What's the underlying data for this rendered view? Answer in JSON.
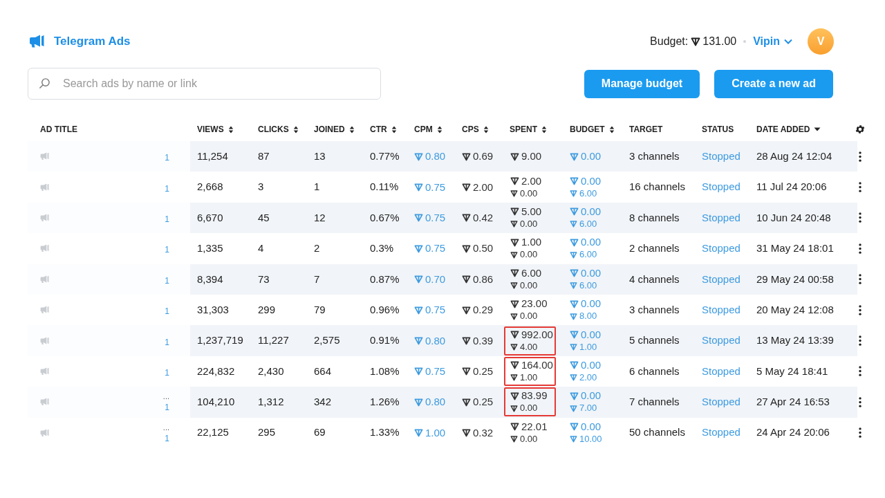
{
  "header": {
    "brand": "Telegram Ads",
    "budget_label": "Budget:",
    "budget_value": "131.00",
    "account": "Vipin",
    "avatar": "V"
  },
  "search": {
    "placeholder": "Search ads by name or link"
  },
  "buttons": [
    "Manage budget",
    "Create a new ad"
  ],
  "columns": [
    {
      "label": "AD TITLE",
      "sortable": false,
      "sorted": false
    },
    {
      "label": "VIEWS",
      "sortable": true,
      "sorted": false
    },
    {
      "label": "CLICKS",
      "sortable": true,
      "sorted": false
    },
    {
      "label": "JOINED",
      "sortable": true,
      "sorted": false
    },
    {
      "label": "CTR",
      "sortable": true,
      "sorted": false
    },
    {
      "label": "CPM",
      "sortable": true,
      "sorted": false
    },
    {
      "label": "CPS",
      "sortable": true,
      "sorted": false
    },
    {
      "label": "SPENT",
      "sortable": true,
      "sorted": false
    },
    {
      "label": "BUDGET",
      "sortable": true,
      "sorted": false
    },
    {
      "label": "TARGET",
      "sortable": false,
      "sorted": false
    },
    {
      "label": "STATUS",
      "sortable": false,
      "sorted": false
    },
    {
      "label": "DATE ADDED",
      "sortable": false,
      "sorted": true
    }
  ],
  "rows": [
    {
      "title_end": "",
      "link_end": "1",
      "views": "11,254",
      "clicks": "87",
      "joined": "13",
      "ctr": "0.77%",
      "cpm": "0.80",
      "cps": "0.69",
      "spent": [
        "9.00"
      ],
      "highlighted": false,
      "budget": [
        "0.00"
      ],
      "target": "3 channels",
      "status": "Stopped",
      "date": "28 Aug 24 12:04"
    },
    {
      "title_end": "",
      "link_end": "1",
      "views": "2,668",
      "clicks": "3",
      "joined": "1",
      "ctr": "0.11%",
      "cpm": "0.75",
      "cps": "2.00",
      "spent": [
        "2.00",
        "0.00"
      ],
      "highlighted": false,
      "budget": [
        "0.00",
        "6.00"
      ],
      "target": "16 channels",
      "status": "Stopped",
      "date": "11 Jul 24 20:06"
    },
    {
      "title_end": "",
      "link_end": "1",
      "views": "6,670",
      "clicks": "45",
      "joined": "12",
      "ctr": "0.67%",
      "cpm": "0.75",
      "cps": "0.42",
      "spent": [
        "5.00",
        "0.00"
      ],
      "highlighted": false,
      "budget": [
        "0.00",
        "6.00"
      ],
      "target": "8 channels",
      "status": "Stopped",
      "date": "10 Jun 24 20:48"
    },
    {
      "title_end": "",
      "link_end": "1",
      "views": "1,335",
      "clicks": "4",
      "joined": "2",
      "ctr": "0.3%",
      "cpm": "0.75",
      "cps": "0.50",
      "spent": [
        "1.00",
        "0.00"
      ],
      "highlighted": false,
      "budget": [
        "0.00",
        "6.00"
      ],
      "target": "2 channels",
      "status": "Stopped",
      "date": "31 May 24 18:01"
    },
    {
      "title_end": "",
      "link_end": "1",
      "views": "8,394",
      "clicks": "73",
      "joined": "7",
      "ctr": "0.87%",
      "cpm": "0.70",
      "cps": "0.86",
      "spent": [
        "6.00",
        "0.00"
      ],
      "highlighted": false,
      "budget": [
        "0.00",
        "6.00"
      ],
      "target": "4 channels",
      "status": "Stopped",
      "date": "29 May 24 00:58"
    },
    {
      "title_end": "",
      "link_end": "1",
      "views": "31,303",
      "clicks": "299",
      "joined": "79",
      "ctr": "0.96%",
      "cpm": "0.75",
      "cps": "0.29",
      "spent": [
        "23.00",
        "0.00"
      ],
      "highlighted": false,
      "budget": [
        "0.00",
        "8.00"
      ],
      "target": "3 channels",
      "status": "Stopped",
      "date": "20 May 24 12:08"
    },
    {
      "title_end": "",
      "link_end": "1",
      "views": "1,237,719",
      "clicks": "11,227",
      "joined": "2,575",
      "ctr": "0.91%",
      "cpm": "0.80",
      "cps": "0.39",
      "spent": [
        "992.00",
        "4.00"
      ],
      "highlighted": true,
      "budget": [
        "0.00",
        "1.00"
      ],
      "target": "5 channels",
      "status": "Stopped",
      "date": "13 May 24 13:39"
    },
    {
      "title_end": "",
      "link_end": "1",
      "views": "224,832",
      "clicks": "2,430",
      "joined": "664",
      "ctr": "1.08%",
      "cpm": "0.75",
      "cps": "0.25",
      "spent": [
        "164.00",
        "1.00"
      ],
      "highlighted": true,
      "budget": [
        "0.00",
        "2.00"
      ],
      "target": "6 channels",
      "status": "Stopped",
      "date": "5 May 24 18:41"
    },
    {
      "title_end": "...",
      "link_end": "1",
      "views": "104,210",
      "clicks": "1,312",
      "joined": "342",
      "ctr": "1.26%",
      "cpm": "0.80",
      "cps": "0.25",
      "spent": [
        "83.99",
        "0.00"
      ],
      "highlighted": true,
      "budget": [
        "0.00",
        "7.00"
      ],
      "target": "7 channels",
      "status": "Stopped",
      "date": "27 Apr 24 16:53"
    },
    {
      "title_end": "...",
      "link_end": "1",
      "views": "22,125",
      "clicks": "295",
      "joined": "69",
      "ctr": "1.33%",
      "cpm": "1.00",
      "cps": "0.32",
      "spent": [
        "22.01",
        "0.00"
      ],
      "highlighted": false,
      "budget": [
        "0.00",
        "10.00"
      ],
      "target": "50 channels",
      "status": "Stopped",
      "date": "24 Apr 24 20:06"
    }
  ]
}
